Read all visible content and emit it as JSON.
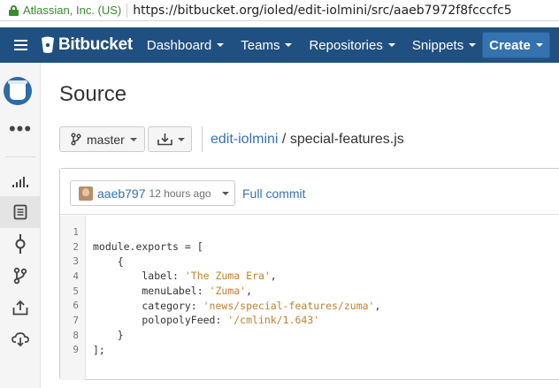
{
  "browser": {
    "security_label": "Atlassian, Inc. (US)",
    "url": "https://bitbucket.org/ioled/edit-iolmini/src/aaeb7972f8fcccfc5"
  },
  "nav": {
    "brand": "Bitbucket",
    "items": [
      "Dashboard",
      "Teams",
      "Repositories",
      "Snippets"
    ],
    "create_label": "Create",
    "color": "#205081",
    "create_color": "#3572b0"
  },
  "sidebar": {
    "items": [
      "repo-avatar",
      "more-icon",
      "overview-icon",
      "source-icon",
      "commits-icon",
      "branches-icon",
      "pull-requests-icon",
      "downloads-icon"
    ],
    "active": "source-icon",
    "more_label": "•••"
  },
  "page": {
    "title": "Source"
  },
  "toolbar": {
    "branch_label": "master",
    "breadcrumb_repo": "edit-iolmini",
    "breadcrumb_sep": " / ",
    "breadcrumb_file": "special-features.js"
  },
  "commit": {
    "hash": "aaeb797",
    "time": "12 hours ago",
    "full_commit_label": "Full commit"
  },
  "code": {
    "lines": [
      {
        "n": "1",
        "text": ""
      },
      {
        "n": "2",
        "text": "module.exports = ["
      },
      {
        "n": "3",
        "text": "    {"
      },
      {
        "n": "4",
        "key": "        label: ",
        "str": "'The Zuma Era'",
        "end": ","
      },
      {
        "n": "5",
        "key": "        menuLabel: ",
        "str": "'Zuma'",
        "end": ","
      },
      {
        "n": "6",
        "key": "        category: ",
        "str": "'news/special-features/zuma'",
        "end": ","
      },
      {
        "n": "7",
        "key": "        polopolyFeed: ",
        "str": "'/cmlink/1.643'",
        "end": ""
      },
      {
        "n": "8",
        "text": "    }"
      },
      {
        "n": "9",
        "text": "];"
      }
    ]
  }
}
